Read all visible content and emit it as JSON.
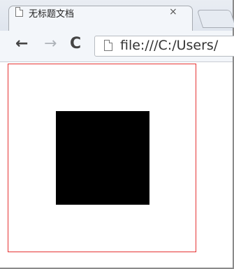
{
  "browser": {
    "tab": {
      "title": "无标题文档",
      "close_glyph": "×",
      "icon": "document-icon"
    },
    "toolbar": {
      "back_glyph": "←",
      "forward_glyph": "→",
      "reload_glyph": "C",
      "address": "file:///C:/Users/"
    }
  },
  "page": {
    "box_border_color": "#e53333",
    "square_color": "#000000"
  }
}
